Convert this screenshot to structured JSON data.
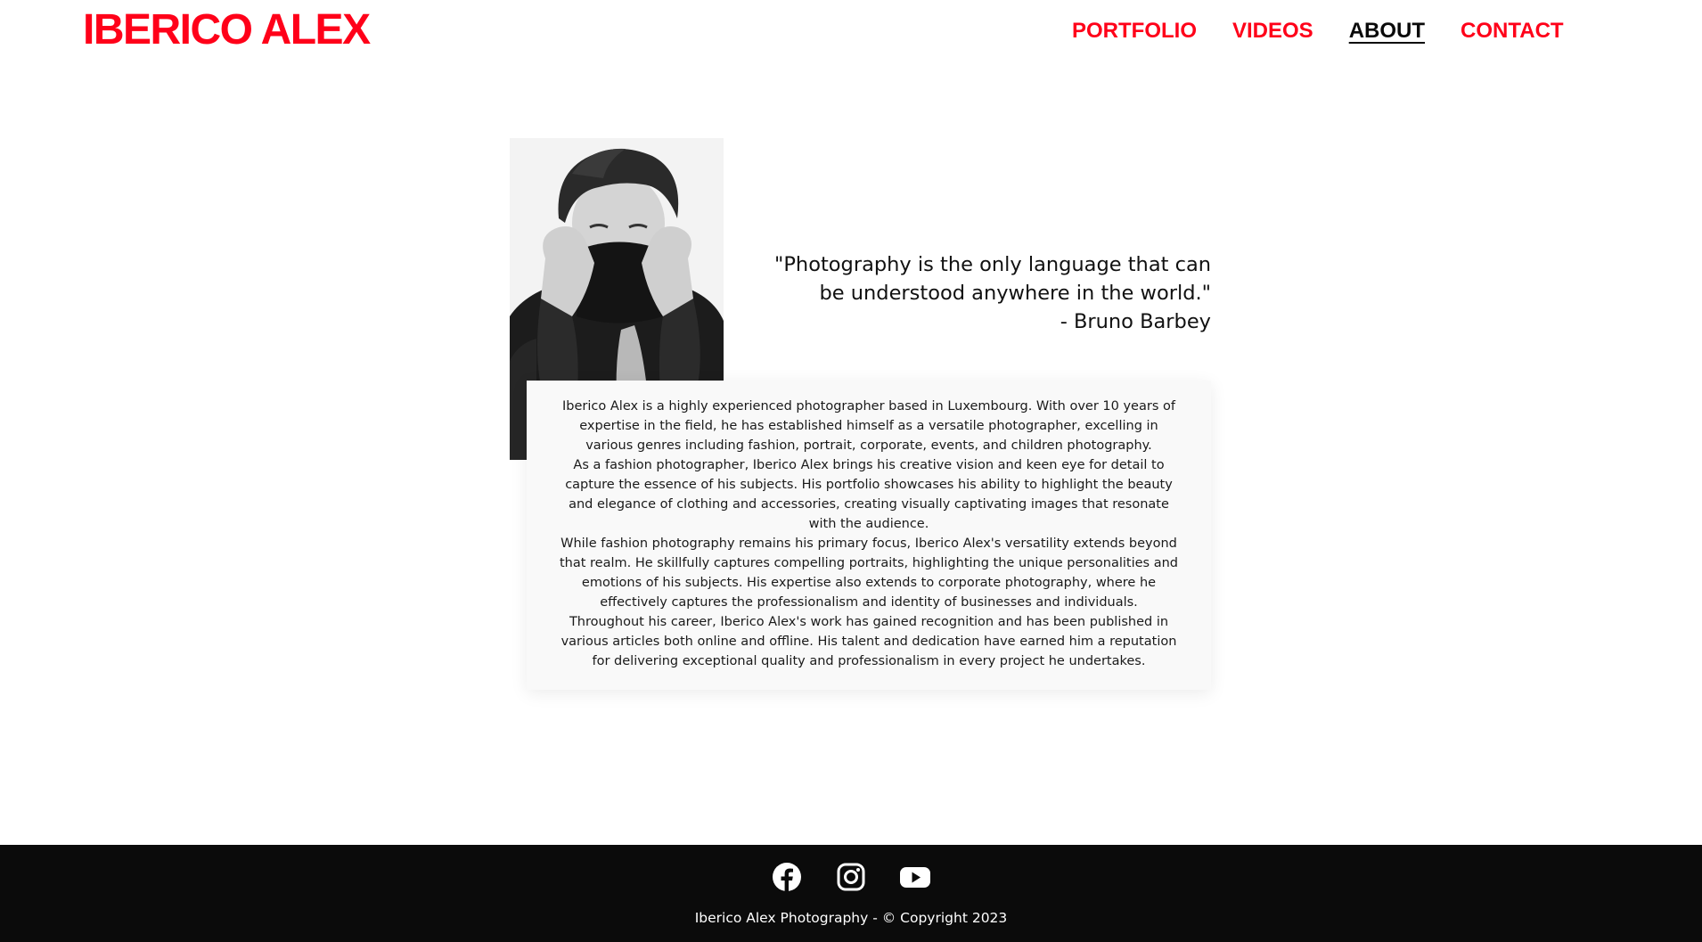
{
  "header": {
    "logo": "IBERICO ALEX",
    "nav": [
      {
        "label": "PORTFOLIO",
        "active": false
      },
      {
        "label": "VIDEOS",
        "active": false
      },
      {
        "label": "ABOUT",
        "active": true
      },
      {
        "label": "CONTACT",
        "active": false
      }
    ]
  },
  "main": {
    "portrait_icon": "person-portrait-photo",
    "quote": {
      "line1": "\"Photography is the only language that can",
      "line2": "be understood anywhere in the world.\"",
      "author": "- Bruno Barbey"
    },
    "bio": {
      "paragraphs": [
        "Iberico Alex is a highly experienced photographer based in Luxembourg. With over 10 years of expertise in the field, he has established himself as a versatile photographer, excelling in various genres including fashion, portrait, corporate, events, and children photography.",
        "As a fashion photographer, Iberico Alex brings his creative vision and keen eye for detail to capture the essence of his subjects. His portfolio showcases his ability to highlight the beauty and elegance of clothing and accessories, creating visually captivating images that resonate with the audience.",
        "While fashion photography remains his primary focus, Iberico Alex's versatility extends beyond that realm. He skillfully captures compelling portraits, highlighting the unique personalities and emotions of his subjects. His expertise also extends to corporate photography, where he effectively captures the professionalism and identity of businesses and individuals.",
        "Throughout his career, Iberico Alex's work has gained recognition and has been published in various articles both online and offline. His talent and dedication have earned him a reputation for delivering exceptional quality and professionalism in every project he undertakes."
      ]
    }
  },
  "footer": {
    "socials": [
      {
        "icon": "facebook-icon"
      },
      {
        "icon": "instagram-icon"
      },
      {
        "icon": "youtube-icon"
      }
    ],
    "copyright": "Iberico Alex Photography - © Copyright 2023"
  },
  "colors": {
    "brand_red": "#ff0019",
    "text_dark": "#0a0a0a",
    "footer_bg": "#0b0b0b",
    "card_bg": "#f9f9f9"
  }
}
